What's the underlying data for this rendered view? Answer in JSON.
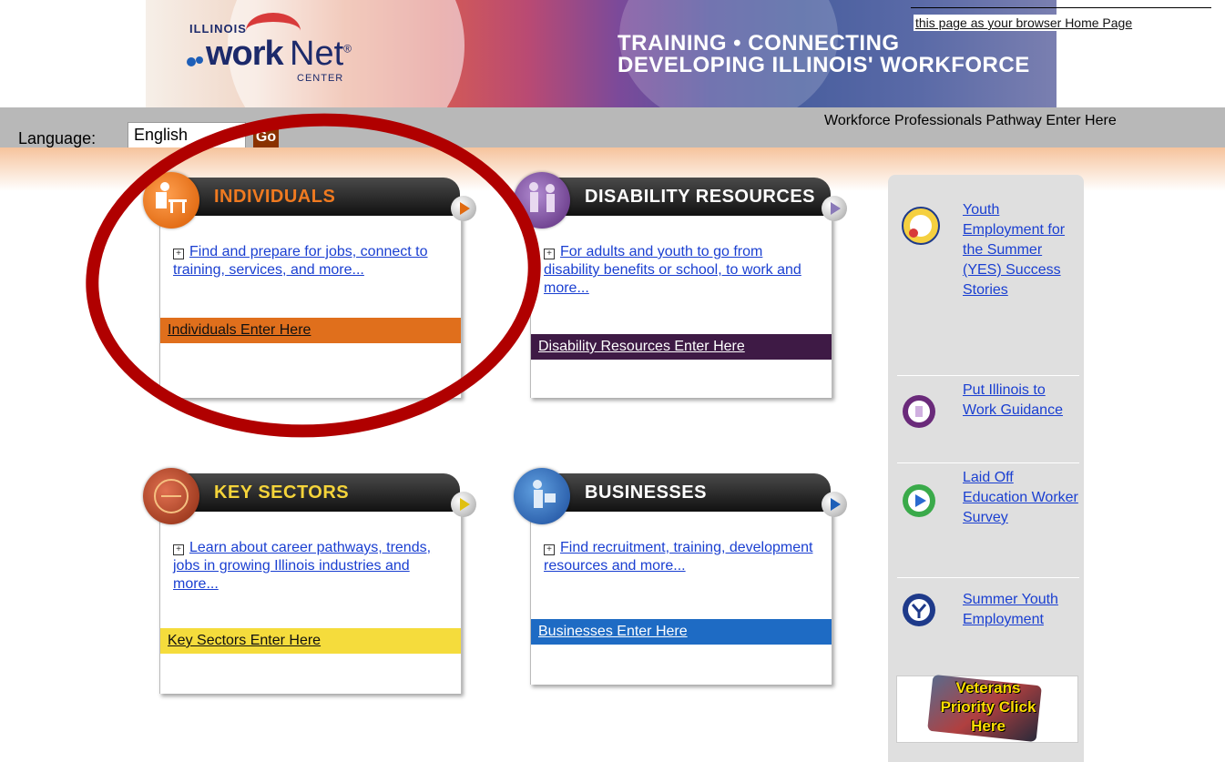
{
  "header": {
    "logo": {
      "state": "ILLINOIS",
      "work": "work",
      "net": "Net",
      "reg": "®",
      "center": "CENTER"
    },
    "tagline_line1": "TRAINING • CONNECTING",
    "tagline_line2": "DEVELOPING ILLINOIS' WORKFORCE",
    "homepage_link": "this page as your browser Home Page"
  },
  "toolbar": {
    "language_label": "Language:",
    "language_value": "English",
    "go_label": "Go",
    "professionals_link": "Workforce Professionals Pathway Enter Here"
  },
  "cards": [
    {
      "title": "INDIVIDUALS",
      "title_color": "#f07a20",
      "footer_color": "#e06f1c",
      "arrow_color": "#e06a10",
      "body": "Find and prepare for jobs, connect to training, services, and more...",
      "footer": "Individuals Enter Here",
      "footer_text_color": "#111111"
    },
    {
      "title": "DISABILITY RESOURCES",
      "title_color": "#ffffff",
      "footer_color": "#3e1a45",
      "arrow_color": "#8a7ab8",
      "body": "For adults and youth to go from disability benefits or school, to work and more...",
      "footer": "Disability Resources Enter Here",
      "footer_text_color": "#ffffff"
    },
    {
      "title": "KEY SECTORS",
      "title_color": "#f5d43a",
      "footer_color": "#f5dc3c",
      "arrow_color": "#e0c010",
      "body": "Learn about career pathways, trends, jobs in growing Illinois industries and more...",
      "footer": "Key Sectors Enter Here",
      "footer_text_color": "#111111"
    },
    {
      "title": "BUSINESSES",
      "title_color": "#ffffff",
      "footer_color": "#1e6bc4",
      "arrow_color": "#1e5fb8",
      "body": "Find recruitment, training, development resources and more...",
      "footer": "Businesses Enter Here",
      "footer_text_color": "#ffffff"
    }
  ],
  "sidebar": {
    "items": [
      {
        "label": "Youth Employment for the Summer (YES) Success Stories",
        "icon": "yes-logo-icon"
      },
      {
        "label": "Put Illinois to Work Guidance ",
        "icon": "work-guidance-icon"
      },
      {
        "label": "Laid Off Education Worker Survey",
        "icon": "survey-play-icon"
      },
      {
        "label": "Summer Youth Employment",
        "icon": "youth-logo-icon"
      }
    ],
    "veterans": "Veterans Priority Click Here"
  }
}
